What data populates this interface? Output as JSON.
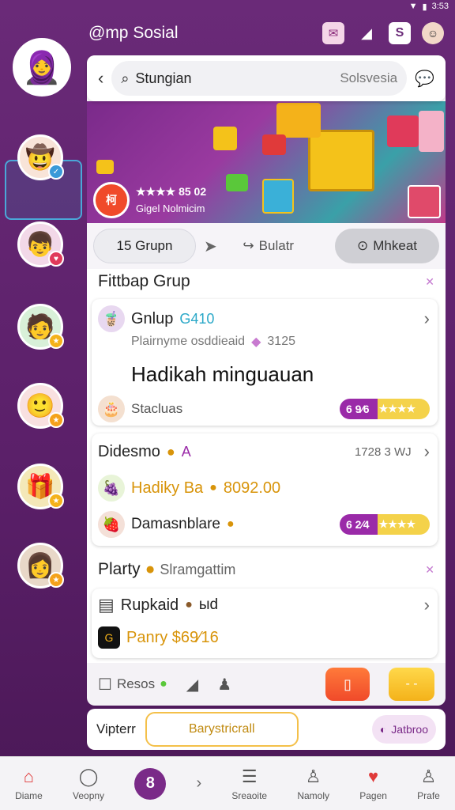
{
  "status": {
    "right_text": "3:53"
  },
  "app": {
    "title": "@mp Sosial"
  },
  "search": {
    "value": "Stungian",
    "hint": "Solsvesia"
  },
  "banner": {
    "rating": "★★★★ 85 02",
    "subtitle": "Gigel Nolmicim"
  },
  "filters": {
    "chip1": "15 Grupn",
    "chip2": "Bulatr",
    "chip3": "Mhkeat"
  },
  "section1": {
    "title": "Fittbap Grup"
  },
  "card1": {
    "title": "Gnlup",
    "title_accent": "G410",
    "desc": "Plairnyme osddieaid",
    "desc_num": "3125",
    "big_text": "Hadikah minguauan",
    "status": "Stacluas",
    "pill": "6 9⁄6"
  },
  "card2": {
    "title": "Didesmo",
    "title_accent": "A",
    "meta": "1728 3 WJ",
    "line1": "Hadiky Ba",
    "line1_value": "8092.00",
    "line2": "Damasnblare",
    "pill": "6 2⁄4"
  },
  "section2": {
    "title": "Plarty",
    "subtitle": "Slramgattim"
  },
  "card3": {
    "line1": "Rupkaid",
    "line1_suffix": "ыd",
    "line2": "Panry $69⁄16"
  },
  "action": {
    "label": "Resos"
  },
  "strip": {
    "left": "Vipterr",
    "button": "Barystricrall",
    "right": "Jatbroo"
  },
  "nav": [
    {
      "label": "Diame"
    },
    {
      "label": "Veopny"
    },
    {
      "label": "8"
    },
    {
      "label": "Sreaoite"
    },
    {
      "label": "Namoly"
    },
    {
      "label": "Pagen"
    },
    {
      "label": "Prafe"
    }
  ],
  "colors": {
    "primary": "#6a2a78",
    "accent_gold": "#d8940a",
    "pill_purple": "#9a2aa8"
  }
}
